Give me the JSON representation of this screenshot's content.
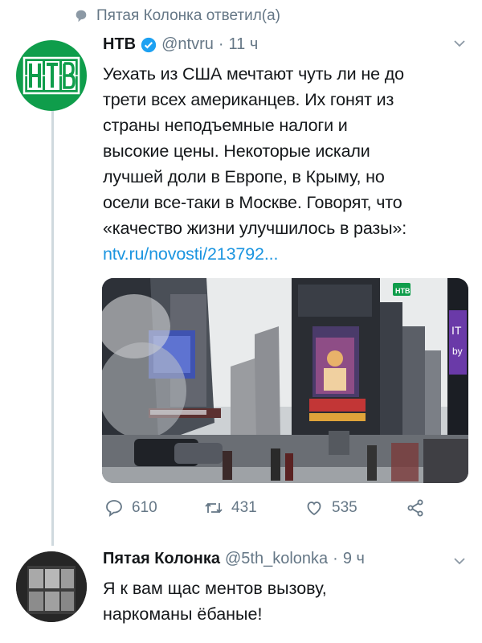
{
  "reply_context": {
    "icon": "speech-bubble-icon",
    "text": "Пятая Колонка ответил(а)"
  },
  "tweet": {
    "avatar_label": "НТВ",
    "name": "НТВ",
    "verified": true,
    "handle": "@ntvru",
    "separator": "·",
    "time": "11 ч",
    "text_lines": [
      "Уехать из США мечтают чуть ли не до",
      "трети всех американцев. Их гонят из",
      "страны неподъемные налоги и",
      "высокие цены. Некоторые искали",
      "лучшей доли в Европе, в Крыму, но",
      "осели все-таки в Москве. Говорят, что",
      "«качество жизни улучшилось в разы»:"
    ],
    "link": "ntv.ru/novosti/213792...",
    "media": {
      "watermark": "НТВ",
      "billboard_text": [
        "IT",
        "by"
      ]
    },
    "stats": {
      "replies": "610",
      "retweets": "431",
      "likes": "535"
    }
  },
  "reply": {
    "name": "Пятая Колонка",
    "handle": "@5th_kolonka",
    "separator": "·",
    "time": "9 ч",
    "text_lines": [
      "Я к вам щас ментов вызову,",
      "наркоманы ёбаные!"
    ]
  },
  "colors": {
    "ntv_green": "#0f9d4b",
    "link_blue": "#1b95e0",
    "muted_gray": "#657786",
    "verified_blue": "#1da1f2"
  }
}
